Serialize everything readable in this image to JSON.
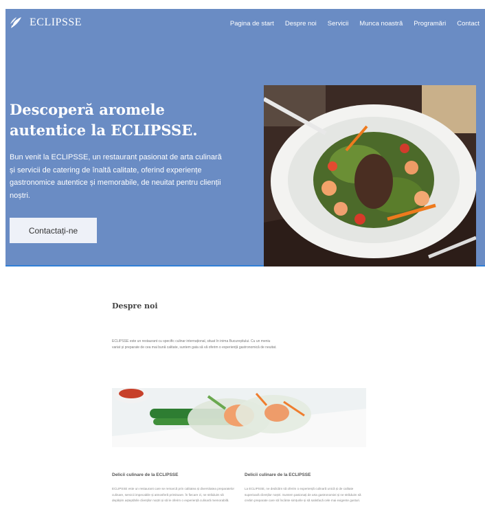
{
  "brand": {
    "name": "ECLIPSSE",
    "logo_icon": "leaf-logo-icon"
  },
  "nav": {
    "items": [
      {
        "label": "Pagina de start"
      },
      {
        "label": "Despre noi"
      },
      {
        "label": "Servicii"
      },
      {
        "label": "Munca noastră"
      },
      {
        "label": "Programări"
      },
      {
        "label": "Contact"
      }
    ]
  },
  "hero": {
    "title": "Descoperă aromele autentice la ECLIPSSE.",
    "text": "Bun venit la ECLIPSSE, un restaurant pasionat de arta culinară și servicii de catering de înaltă calitate, oferind experiențe gastronomice autentice și memorabile, de neuitat pentru clienții noștri.",
    "button_label": "Contactați-ne"
  },
  "about": {
    "title": "Despre noi",
    "text": "ECLIPSSE este un restaurant cu specific culinar internațional, situat în inima Bucureștiului. Cu un meniu variat și preparate de cea mai bună calitate, suntem gata să vă oferim o experiență gastronomică de neuitat.",
    "columns": [
      {
        "title": "Delicii culinare de la ECLIPSSE",
        "text": "ECLIPSSE este un restaurant care se remarcă prin calitatea și diversitatea preparatelor culinare, servicii impecabile și atmosferă primitoare. În fiecare zi, ne străduim să depășim așteptările clienților noștri și să le oferim o experiență culinară memorabilă."
      },
      {
        "title": "Delicii culinare de la ECLIPSSE",
        "text": "La ECLIPSSE, ne dedicăm să oferim o experiență culinară unică și de calitate superioară clienților noștri. Suntem pasionați de arta gastronomiei și ne străduim să creăm preparate care să încânte simțurile și să satisfacă cele mai exigente gusturi."
      }
    ]
  },
  "colors": {
    "hero_bg": "#6a8cc4",
    "button_bg": "#eef1f8",
    "hero_border": "#2f7fd6"
  }
}
